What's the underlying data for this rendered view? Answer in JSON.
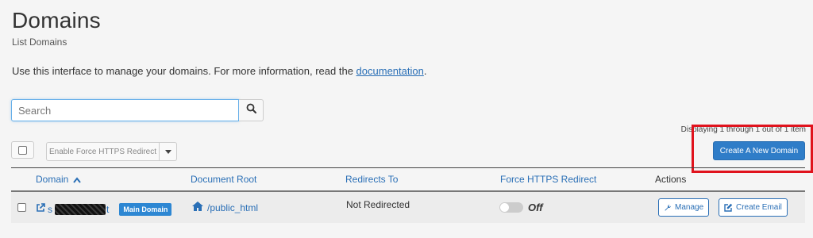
{
  "header": {
    "title": "Domains",
    "subtitle": "List Domains",
    "intro_text": "Use this interface to manage your domains. For more information, read the ",
    "intro_link": "documentation",
    "intro_end": "."
  },
  "search": {
    "placeholder": "Search",
    "value": ""
  },
  "display_count": "Displaying 1 through 1 out of 1 item",
  "toolbar": {
    "bulk_action_label": "Enable Force HTTPS Redirect",
    "create_button_label": "Create A New Domain"
  },
  "table": {
    "headers": {
      "domain": "Domain",
      "document_root": "Document Root",
      "redirects_to": "Redirects To",
      "force_https": "Force HTTPS Redirect",
      "actions": "Actions"
    },
    "rows": [
      {
        "domain_prefix": "s",
        "domain_suffix": "t",
        "badge": "Main Domain",
        "document_root": "/public_html",
        "redirects_to": "Not Redirected",
        "force_https_state": "Off",
        "manage_label": "Manage",
        "create_email_label": "Create Email"
      }
    ]
  },
  "colors": {
    "link": "#2a6fb6",
    "primary_button": "#2f7dc8",
    "badge": "#2d87d3",
    "highlight": "#e0131d"
  },
  "icons": {
    "search": "search-icon",
    "external_link": "external-link-icon",
    "home": "home-icon",
    "wrench": "wrench-icon",
    "edit": "edit-icon",
    "sort": "chevron-up-icon",
    "caret": "caret-down-icon"
  }
}
